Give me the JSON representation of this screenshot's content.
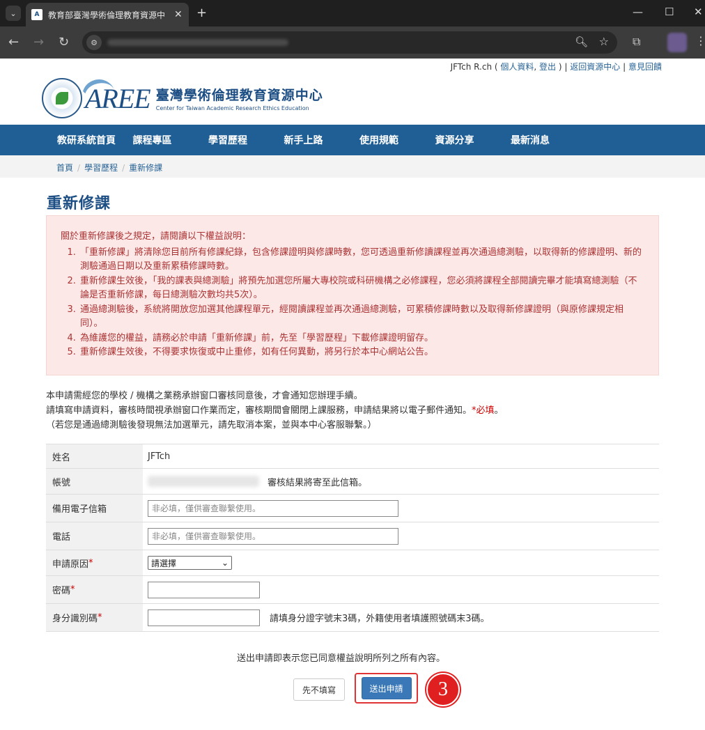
{
  "browser": {
    "tab_title": "教育部臺灣學術倫理教育資源中",
    "tab_close": "✕",
    "new_tab": "+",
    "minimize": "—",
    "maximize": "☐",
    "close": "✕"
  },
  "topline": {
    "user": "JFTch R.ch (",
    "profile_link": "個人資料",
    "comma": ",",
    "logout_link": "登出",
    "sep1": ") |",
    "back_link": "返回資源中心",
    "sep2": "|",
    "feedback_link": "意見回饋"
  },
  "logo": {
    "aree": "AREE",
    "cn": "臺灣學術倫理教育資源中心",
    "en": "Center for Taiwan Academic Research Ethics Education"
  },
  "nav": [
    "教研系統首頁",
    "課程專區",
    "學習歷程",
    "新手上路",
    "使用規範",
    "資源分享",
    "最新消息"
  ],
  "breadcrumb": [
    "首頁",
    "學習歷程",
    "重新修課"
  ],
  "page_title": "重新修課",
  "notice": {
    "title": "關於重新修課後之規定，請閱讀以下權益說明：",
    "items": [
      "「重新修課」將清除您目前所有修課紀錄，包含修課證明與修課時數，您可透過重新修讀課程並再次通過總測驗，以取得新的修課證明、新的測驗通過日期以及重新累積修課時數。",
      "重新修課生效後，「我的課表與總測驗」將預先加選您所屬大專校院或科研機構之必修課程，您必須將課程全部閱讀完畢才能填寫總測驗（不論是否重新修課，每日總測驗次數均共5次）。",
      "通過總測驗後，系統將開放您加選其他課程單元，經閱讀課程並再次通過總測驗，可累積修課時數以及取得新修課證明（與原修課規定相同）。",
      "為維護您的權益，請務必於申請「重新修課」前，先至「學習歷程」下載修課證明留存。",
      "重新修課生效後，不得要求恢復或中止重修，如有任何異動，將另行於本中心網站公告。"
    ]
  },
  "intro": {
    "line1": "本申請需經您的學校 / 機構之業務承辦窗口審核同意後，才會通知您辦理手續。",
    "line2": "請填寫申請資料，審核時間視承辦窗口作業而定，審核期間會關閉上課服務，申請結果將以電子郵件通知。",
    "required_note": "*必填",
    "line2_end": "。",
    "line3": "（若您是通過總測驗後發現無法加選單元，請先取消本案，並與本中心客服聯繫。）"
  },
  "form": {
    "name_label": "姓名",
    "name_value": "JFTch",
    "account_label": "帳號",
    "account_hint": "審核結果將寄至此信箱。",
    "backup_email_label": "備用電子信箱",
    "backup_email_placeholder": "非必填，僅供審查聯繫使用。",
    "phone_label": "電話",
    "phone_placeholder": "非必填，僅供審查聯繫使用。",
    "reason_label": "申請原因",
    "reason_selected": "請選擇",
    "password_label": "密碼",
    "id_label": "身分識別碼",
    "id_hint": "請填身分證字號末3碼，外籍使用者填護照號碼末3碼。",
    "required_mark": "*"
  },
  "agree_text": "送出申請即表示您已同意權益說明所列之所有內容。",
  "buttons": {
    "skip": "先不填寫",
    "submit": "送出申請"
  },
  "step_badge": "3"
}
